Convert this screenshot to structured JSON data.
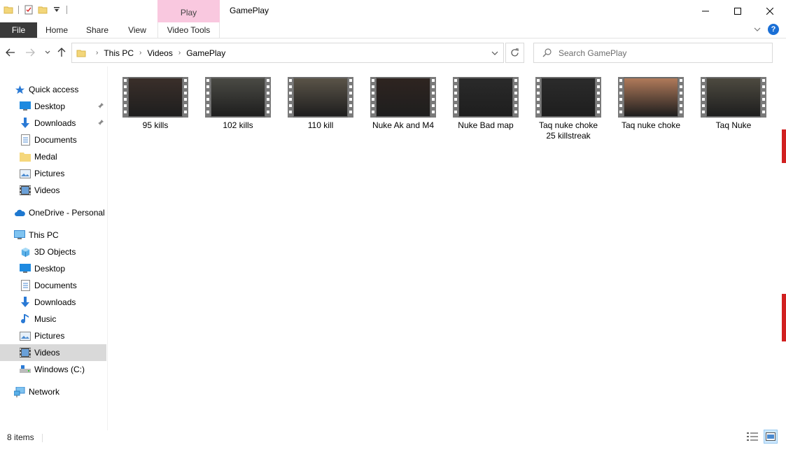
{
  "window": {
    "title": "GamePlay",
    "context_tab_label": "Play"
  },
  "ribbon": {
    "tabs": [
      "File",
      "Home",
      "Share",
      "View",
      "Video Tools"
    ],
    "help_glyph": "?"
  },
  "address": {
    "crumbs": [
      "This PC",
      "Videos",
      "GamePlay"
    ]
  },
  "search": {
    "placeholder": "Search GamePlay"
  },
  "sidebar": {
    "quick_access": "Quick access",
    "quick_items": [
      {
        "label": "Desktop",
        "icon": "desktop-icon",
        "pinned": true
      },
      {
        "label": "Downloads",
        "icon": "downloads-icon",
        "pinned": true
      },
      {
        "label": "Documents",
        "icon": "documents-icon",
        "pinned": false
      },
      {
        "label": "Medal",
        "icon": "folder-icon",
        "pinned": false
      },
      {
        "label": "Pictures",
        "icon": "pictures-icon",
        "pinned": false
      },
      {
        "label": "Videos",
        "icon": "videos-icon",
        "pinned": false
      }
    ],
    "onedrive": "OneDrive - Personal",
    "this_pc": "This PC",
    "pc_items": [
      {
        "label": "3D Objects",
        "icon": "3d-objects-icon"
      },
      {
        "label": "Desktop",
        "icon": "desktop-icon"
      },
      {
        "label": "Documents",
        "icon": "documents-icon"
      },
      {
        "label": "Downloads",
        "icon": "downloads-icon"
      },
      {
        "label": "Music",
        "icon": "music-icon"
      },
      {
        "label": "Pictures",
        "icon": "pictures-icon"
      },
      {
        "label": "Videos",
        "icon": "videos-icon",
        "selected": true
      },
      {
        "label": "Windows (C:)",
        "icon": "drive-icon"
      }
    ],
    "network": "Network"
  },
  "files": [
    {
      "name": "95 kills",
      "tone": "#3a2f2a"
    },
    {
      "name": "102 kills",
      "tone": "#4a4a44"
    },
    {
      "name": "110 kill",
      "tone": "#5a5448"
    },
    {
      "name": "Nuke Ak and M4",
      "tone": "#2e2420"
    },
    {
      "name": "Nuke Bad map",
      "tone": "#2a2a2a"
    },
    {
      "name": "Taq nuke choke\n25 killstreak",
      "tone": "#2b2b2b"
    },
    {
      "name": "Taq nuke choke",
      "tone": "#b07a5a"
    },
    {
      "name": "Taq Nuke",
      "tone": "#4d4a40"
    }
  ],
  "status": {
    "item_count": "8 items"
  },
  "colors": {
    "file_tab_bg": "#3a3a3a",
    "context_tab_bg": "#f9c8df",
    "selected_bg": "#d9d9d9",
    "help_blue": "#1a6fd6"
  }
}
